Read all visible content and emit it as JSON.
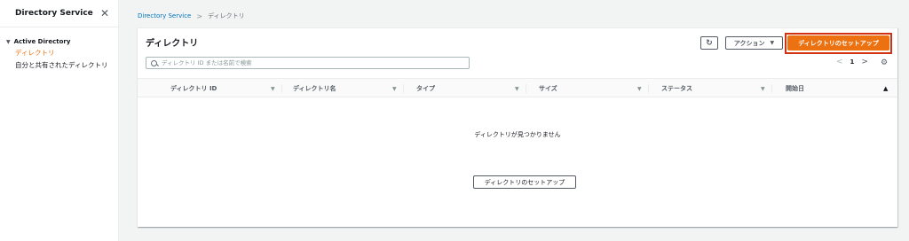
{
  "sidebar": {
    "title": "Directory Service",
    "close_icon": "✕",
    "group": "Active Directory",
    "items": [
      {
        "label": "ディレクトリ"
      },
      {
        "label": "自分と共有されたディレクトリ"
      }
    ]
  },
  "breadcrumb": {
    "root": "Directory Service",
    "separator": ">",
    "current": "ディレクトリ"
  },
  "panel": {
    "title": "ディレクトリ",
    "refresh_icon": "↻",
    "action_label": "アクション",
    "setup_label": "ディレクトリのセットアップ",
    "search_placeholder": "ディレクトリ ID または名前で検索",
    "pager": {
      "prev": "<",
      "page": "1",
      "next": ">"
    },
    "settings_icon": "⚙",
    "columns": [
      {
        "label": "ディレクトリ ID"
      },
      {
        "label": "ディレクトリ名"
      },
      {
        "label": "タイプ"
      },
      {
        "label": "サイズ"
      },
      {
        "label": "ステータス"
      },
      {
        "label": "開始日"
      }
    ],
    "empty_message": "ディレクトリが見つかりません",
    "empty_button": "ディレクトリのセットアップ"
  },
  "colors": {
    "accent": "#ec7211",
    "link": "#0073bb",
    "highlight": "#d13212"
  }
}
